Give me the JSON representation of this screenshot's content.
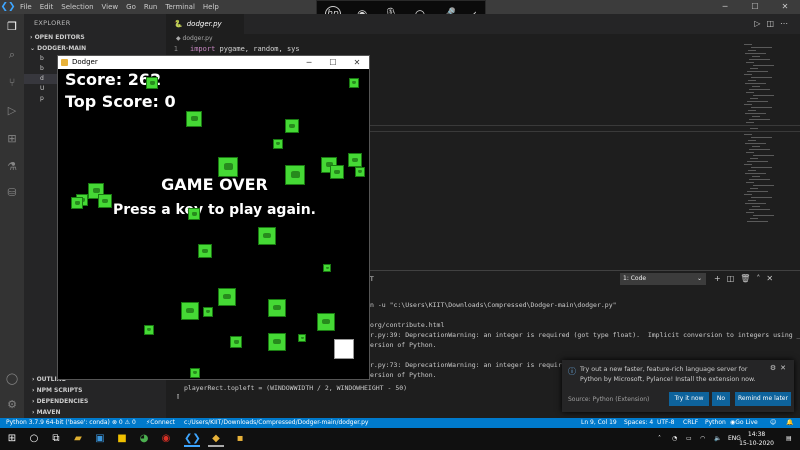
{
  "menu": [
    "File",
    "Edit",
    "Selection",
    "View",
    "Go",
    "Run",
    "Terminal",
    "Help"
  ],
  "hp_overlay": {
    "logo": "hp"
  },
  "sidebar": {
    "title": "EXPLORER",
    "sections": [
      "OPEN EDITORS",
      "DODGER-MAIN"
    ],
    "files": [
      "b",
      "b",
      "d",
      "U",
      "p"
    ],
    "bottom_sections": [
      "OUTLINE",
      "NPM SCRIPTS",
      "DEPENDENCIES",
      "MAVEN"
    ]
  },
  "editor": {
    "tab": "dodger.py",
    "breadcrumb": "dodger.py",
    "line_number": "1",
    "code_keyword": "import",
    "code_rest": "pygame, random, sys"
  },
  "panel": {
    "tab": "T",
    "terminal_select": "1: Code",
    "lines": [
      "n -u \"c:\\Users\\KIIT\\Downloads\\Compressed\\Dodger-main\\dodger.py\"",
      "",
      "org/contribute.html",
      "r.py:39: DeprecationWarning: an integer is required (got type float).  Implicit conversion to integers using __",
      "ersion of Python.",
      "",
      "r.py:73: DeprecationWarning: an integer is required",
      "ersion of Python.",
      "playerRect.topleft = (WINDOWWIDTH / 2, WINDOWHEIGHT - 50)"
    ]
  },
  "toast": {
    "message": "Try out a new faster, feature-rich language server for Python by Microsoft, Pylance! Install the extension now.",
    "source": "Source: Python (Extension)",
    "btn_try": "Try it now",
    "btn_no": "No",
    "btn_later": "Remind me later"
  },
  "game": {
    "window_title": "Dodger",
    "score": "Score: 262",
    "top_score": "Top Score: 0",
    "game_over": "GAME OVER",
    "press_key": "Press a key to play again."
  },
  "statusbar": {
    "python": "Python 3.7.9 64-bit ('base': conda)",
    "problems": "⊗ 0 ⚠ 0",
    "connect": "Connect",
    "path": "c:/Users/KIIT/Downloads/Compressed/Dodger-main/dodger.py",
    "position": "Ln 9, Col 19",
    "spaces": "Spaces: 4",
    "encoding": "UTF-8",
    "eol": "CRLF",
    "language": "Python",
    "golive": "Go Live"
  },
  "taskbar": {
    "lang": "ENG",
    "time": "14:38",
    "date": "15-10-2020"
  },
  "colors": {
    "statusbar": "#007acc",
    "accent": "#0e639c",
    "baddie": "#45d935"
  }
}
